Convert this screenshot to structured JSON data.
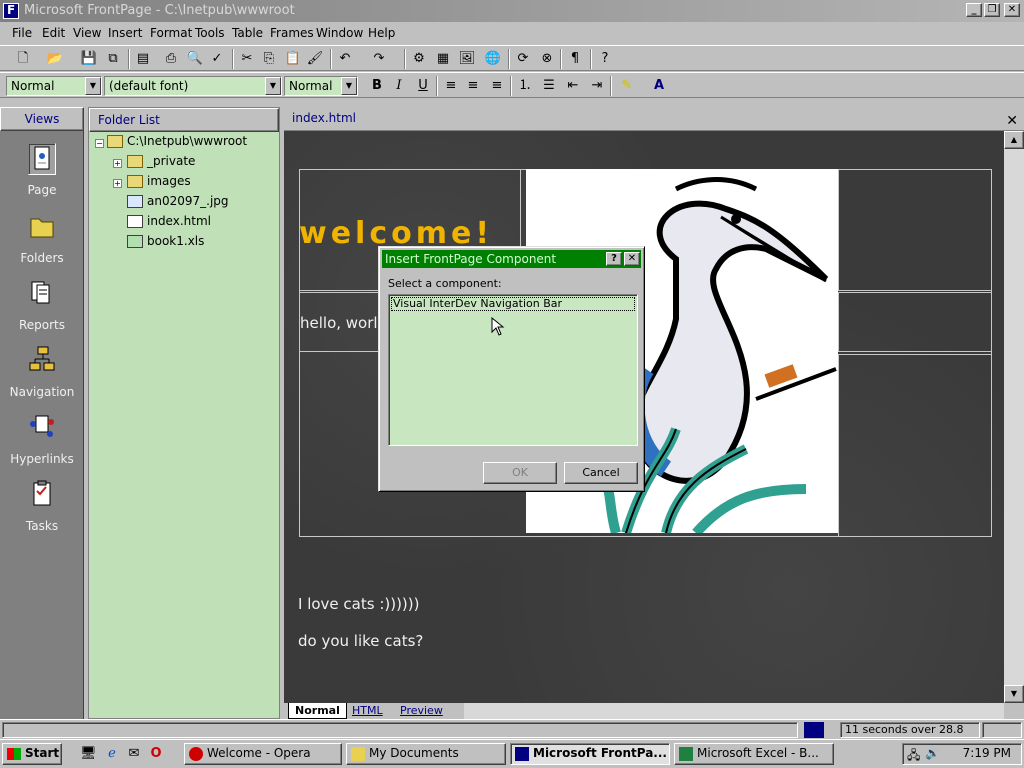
{
  "window": {
    "title": "Microsoft FrontPage - C:\\Inetpub\\wwwroot",
    "minimize": "_",
    "restore": "❐",
    "close": "✕"
  },
  "menu": [
    "File",
    "Edit",
    "View",
    "Insert",
    "Format",
    "Tools",
    "Table",
    "Frames",
    "Window",
    "Help"
  ],
  "format_toolbar": {
    "style": "Normal",
    "font": "(default font)",
    "size": "Normal",
    "bold": "B",
    "italic": "I",
    "underline": "U"
  },
  "views": {
    "header": "Views",
    "items": [
      "Page",
      "Folders",
      "Reports",
      "Navigation",
      "Hyperlinks",
      "Tasks"
    ]
  },
  "folder_list": {
    "header": "Folder List",
    "root": "C:\\Inetpub\\wwwroot",
    "items": [
      "_private",
      "images",
      "an02097_.jpg",
      "index.html",
      "book1.xls"
    ]
  },
  "editor": {
    "tab": "index.html",
    "close": "✕",
    "welcome": "welcome!",
    "hello": "hello, world",
    "love_cats": "I love cats :))))))",
    "like_cats": "do you like cats?",
    "view_tabs": [
      "Normal",
      "HTML",
      "Preview"
    ]
  },
  "dialog": {
    "title": "Insert FrontPage Component",
    "help": "?",
    "close": "✕",
    "prompt": "Select a component:",
    "items": [
      "Visual InterDev Navigation Bar"
    ],
    "ok": "OK",
    "cancel": "Cancel"
  },
  "status": {
    "download": "11 seconds over 28.8"
  },
  "taskbar": {
    "start": "Start",
    "tasks": [
      "Welcome - Opera",
      "My Documents",
      "Microsoft FrontPa...",
      "Microsoft Excel - B..."
    ],
    "clock": "7:19 PM"
  }
}
